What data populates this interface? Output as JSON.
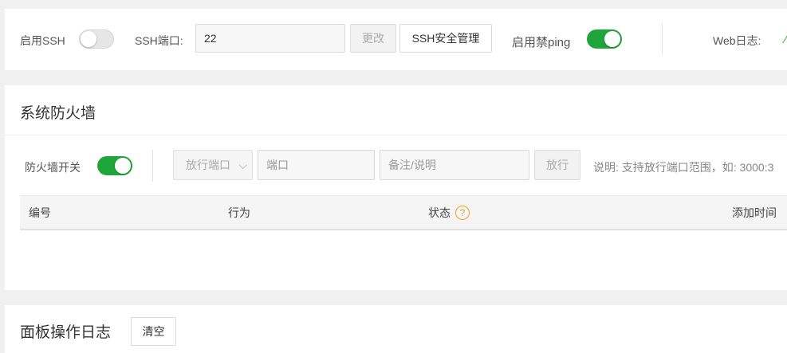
{
  "ssh": {
    "enable_label": "启用SSH",
    "enabled": false,
    "port_label": "SSH端口:",
    "port_value": "22",
    "change_button": "更改",
    "manage_button": "SSH安全管理"
  },
  "ping": {
    "label": "启用禁ping",
    "enabled": true
  },
  "web_log": {
    "label": "Web日志:"
  },
  "firewall": {
    "title": "系统防火墙",
    "switch_label": "防火墙开关",
    "enabled": true,
    "select_value": "放行端口",
    "port_placeholder": "端口",
    "note_placeholder": "备注/说明",
    "allow_button": "放行",
    "hint": "说明: 支持放行端口范围，如: 3000:3",
    "columns": [
      "编号",
      "行为",
      "状态",
      "添加时间"
    ]
  },
  "panel_log": {
    "title": "面板操作日志",
    "clear_button": "清空"
  },
  "colors": {
    "accent_green": "#20a53a",
    "help_orange": "#f0a020"
  }
}
